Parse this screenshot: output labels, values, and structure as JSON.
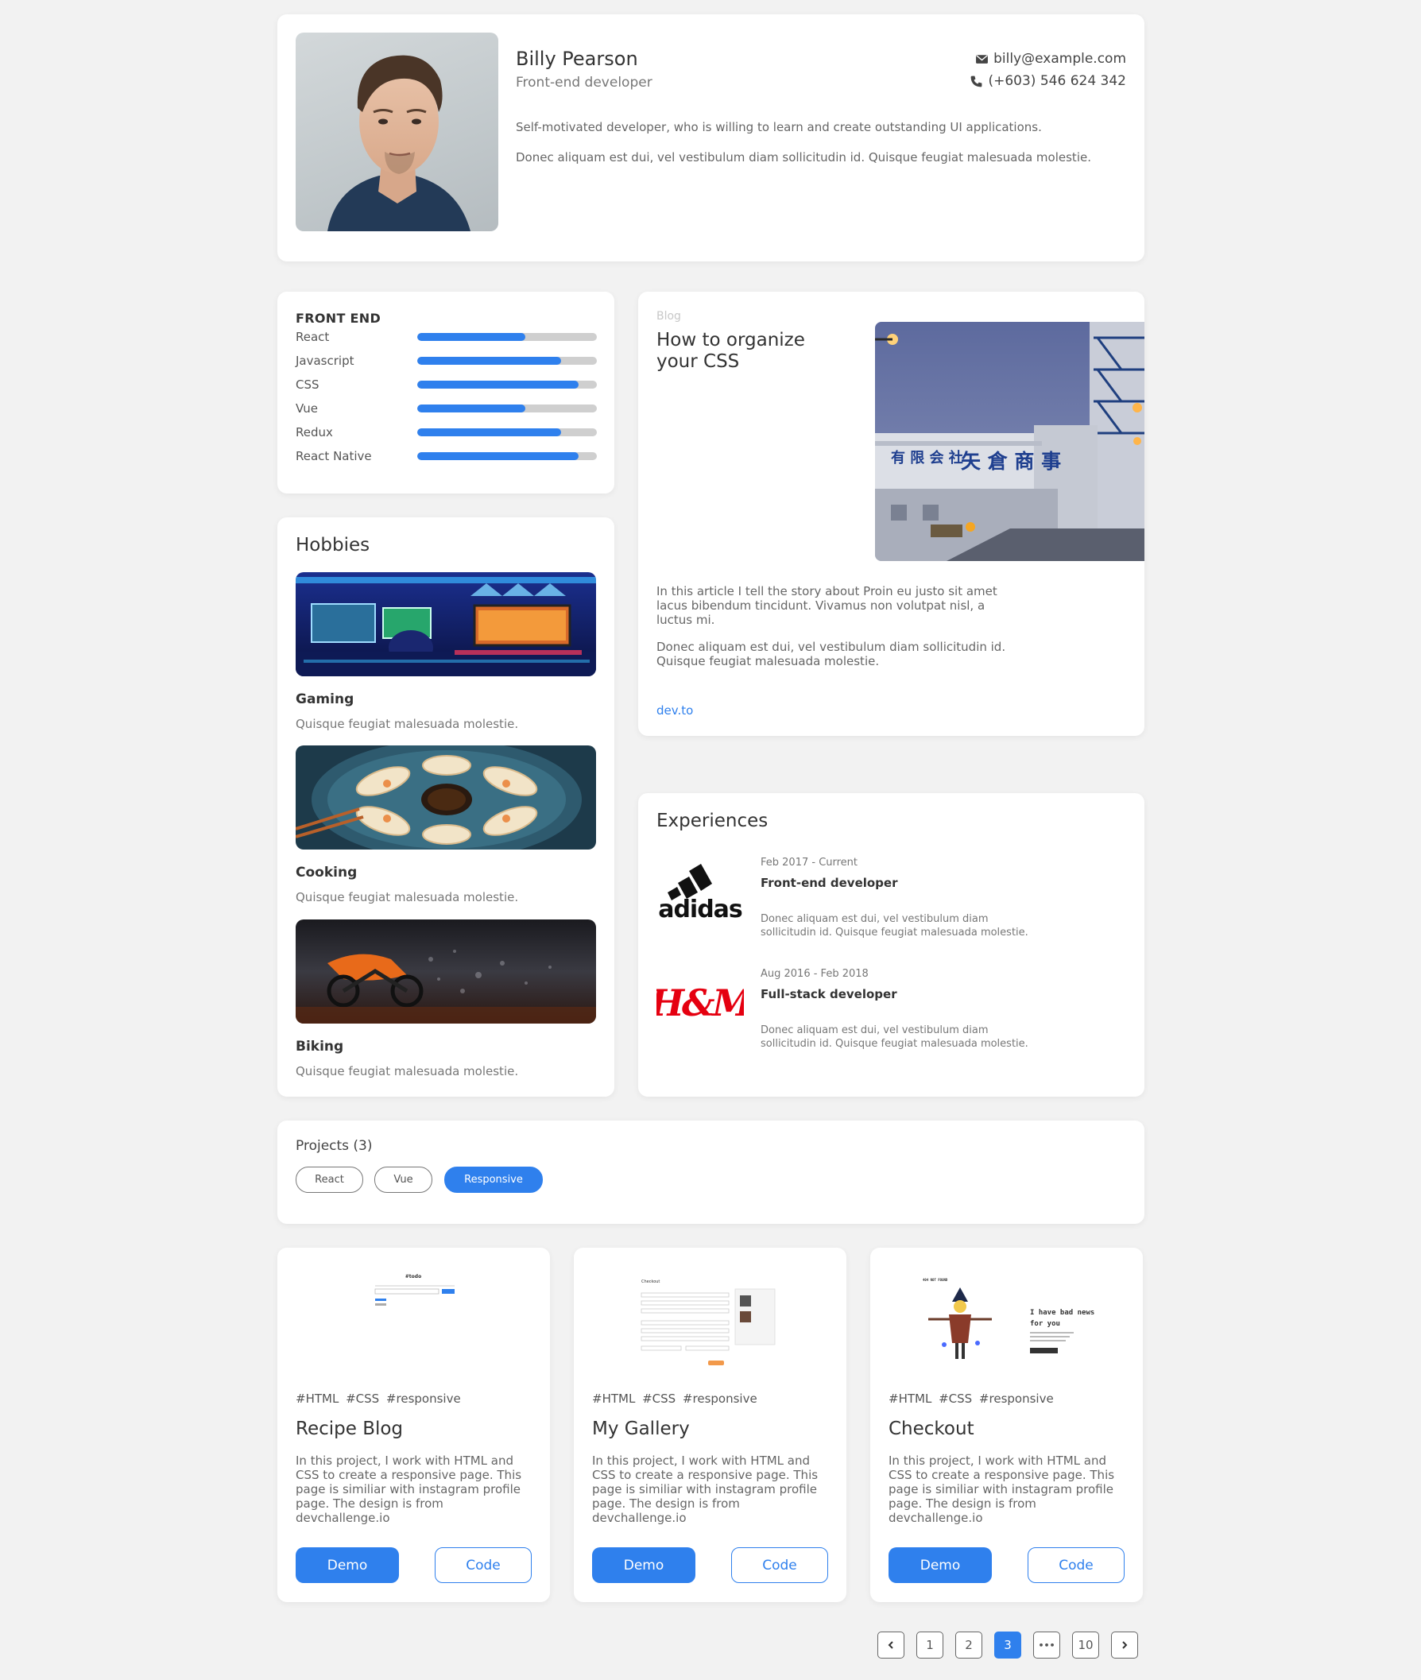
{
  "profile": {
    "name": "Billy Pearson",
    "role": "Front-end developer",
    "email": "billy@example.com",
    "phone": "(+603) 546 624 342",
    "bio": [
      "Self-motivated developer, who is willing to learn and create outstanding UI applications.",
      "Donec aliquam est dui, vel vestibulum diam sollicitudin id. Quisque feugiat malesuada molestie."
    ]
  },
  "skills": {
    "title": "FRONT END",
    "items": [
      {
        "label": "React",
        "level": 0.6
      },
      {
        "label": "Javascript",
        "level": 0.8
      },
      {
        "label": "CSS",
        "level": 0.9
      },
      {
        "label": "Vue",
        "level": 0.6
      },
      {
        "label": "Redux",
        "level": 0.8
      },
      {
        "label": "React Native",
        "level": 0.9
      }
    ]
  },
  "hobbies": {
    "title": "Hobbies",
    "items": [
      {
        "name": "Gaming",
        "desc": "Quisque feugiat malesuada molestie."
      },
      {
        "name": "Cooking",
        "desc": "Quisque feugiat malesuada molestie."
      },
      {
        "name": "Biking",
        "desc": "Quisque feugiat malesuada molestie."
      }
    ]
  },
  "blog": {
    "tag": "Blog",
    "title": "How to organize your CSS",
    "paragraphs": [
      "In this article I tell the story about Proin eu justo sit amet lacus bibendum tincidunt. Vivamus non volutpat nisl, a luctus mi.",
      "Donec aliquam est dui, vel vestibulum diam sollicitudin id. Quisque feugiat malesuada molestie."
    ],
    "link": "dev.to"
  },
  "experiences": {
    "title": "Experiences",
    "items": [
      {
        "company": "adidas",
        "date": "Feb 2017 - Current",
        "role": "Front-end developer",
        "desc": "Donec aliquam est dui, vel vestibulum diam sollicitudin id. Quisque feugiat malesuada molestie."
      },
      {
        "company": "H&M",
        "date": "Aug 2016 - Feb 2018",
        "role": "Full-stack developer",
        "desc": "Donec aliquam est dui, vel vestibulum diam sollicitudin id. Quisque feugiat malesuada molestie."
      }
    ]
  },
  "projects": {
    "title": "Projects (3)",
    "filters": [
      "React",
      "Vue",
      "Responsive"
    ],
    "active_filter": "Responsive",
    "cards": [
      {
        "tags": "#HTML #CSS #responsive",
        "title": "Recipe Blog",
        "desc": "In this project, I work with HTML and CSS to create a responsive page. This page is similiar with instagram profile page. The design is from devchallenge.io",
        "demo": "Demo",
        "code": "Code",
        "thumb_text": [
          "#todo"
        ]
      },
      {
        "tags": "#HTML #CSS #responsive",
        "title": "My Gallery",
        "desc": "In this project, I work with HTML and CSS to create a responsive page. This page is similiar with instagram profile page. The design is from devchallenge.io",
        "demo": "Demo",
        "code": "Code",
        "thumb_text": [
          "Checkout"
        ]
      },
      {
        "tags": "#HTML #CSS #responsive",
        "title": "Checkout",
        "desc": "In this project, I work with HTML and CSS to create a responsive page. This page is similiar with instagram profile page. The design is from devchallenge.io",
        "demo": "Demo",
        "code": "Code",
        "thumb_text": [
          "404 NOT FOUND",
          "I have bad news",
          "for you"
        ]
      }
    ]
  },
  "pagination": {
    "pages": [
      "1",
      "2",
      "3",
      "•••",
      "10"
    ],
    "current": "3"
  },
  "colors": {
    "accent": "#2f80ed",
    "background": "#f2f2f2",
    "hm_red": "#e50010"
  }
}
